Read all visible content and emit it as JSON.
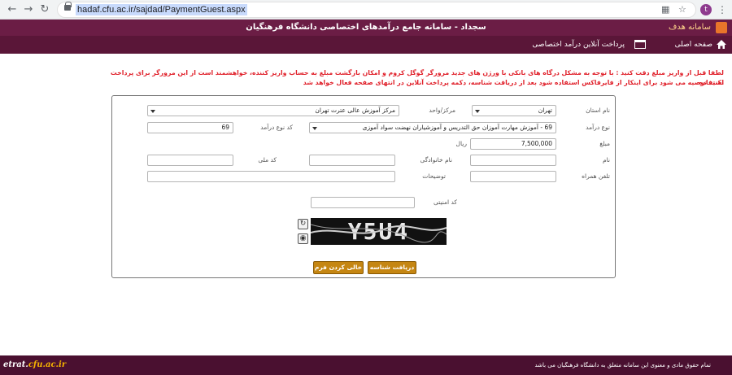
{
  "browser": {
    "url": "hadaf.cfu.ac.ir/sajdad/PaymentGuest.aspx",
    "profile_initial": "t"
  },
  "header": {
    "logo_text": "سامانه هدف",
    "title": "سجداد - سامانه جامع درآمدهای اختصاصی دانشگاه فرهنگیان"
  },
  "nav": {
    "home_label": "صفحه اصلی",
    "payment_label": "پرداخت آنلاین درآمد اختصاصی"
  },
  "warning": {
    "line1": "لطفا قبل از واریز مبلغ دقت کنید : با توجه به مشکل درگاه های بانکی با ورژن های جدید مرورگر گوگل کروم و امکان بازگشت مبلغ به حساب واریز کننده، خواهشمند است از این مرورگر برای پرداخت استفاده",
    "line2": "نکنید توصیه می شود برای اینکار از فایرفاکس استفاده شود بعد از دریافت شناسه، دکمه پرداخت آنلاین در انتهای صفحه فعال خواهد شد"
  },
  "form": {
    "province_label": "نام استان",
    "province_value": "تهران",
    "center_label": "مرکز/واحد",
    "center_value": "مرکز آموزش عالی عترت تهران",
    "income_type_label": "نوع درآمد",
    "income_type_value": "69 - آموزش مهارت آموزان حق التدریس و آموزشیاران نهضت سواد آموزی",
    "income_code_label": "کد نوع درآمد",
    "income_code_value": "69",
    "amount_label": "مبلغ",
    "amount_value": "7,500,000",
    "amount_unit": "ریال",
    "first_name_label": "نام",
    "first_name_value": "",
    "last_name_label": "نام خانوادگی",
    "last_name_value": "",
    "national_code_label": "کد ملی",
    "national_code_value": "",
    "mobile_label": "تلفن همراه",
    "mobile_value": "",
    "description_label": "توضیحات",
    "description_value": "",
    "security_code_label": "کد امنیتی",
    "security_code_value": "",
    "captcha_text": "Y5U4",
    "get_id_button": "دریافت شناسه",
    "clear_button": "خالی کردن فرم"
  },
  "footer": {
    "copyright": "تمام حقوق مادی و معنوی این سامانه متعلق به دانشگاه فرهنگیان می باشد",
    "brand_main": "etrat.",
    "brand_accent": "cfu.ac.ir"
  },
  "colors": {
    "header_bg": "#6b1d45",
    "nav_bg": "#5a1638",
    "footer_bg": "#4a1030",
    "warning_text": "#e0202a",
    "button_bg": "#c58612"
  }
}
